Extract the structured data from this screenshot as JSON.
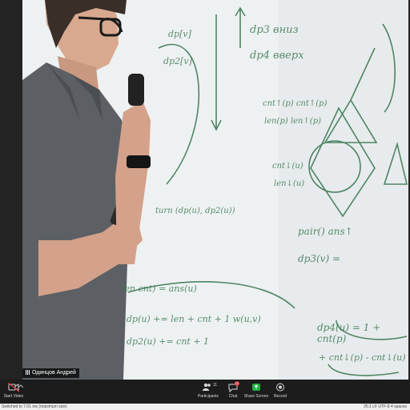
{
  "participant": {
    "name": "Одинцов Андрей"
  },
  "toolbar": {
    "start_video": "Start Video",
    "participants": "Participants",
    "participants_count": "11",
    "chat": "Chat",
    "chat_badge": "12",
    "share_screen": "Share Screen",
    "record": "Record"
  },
  "status": {
    "left": "Switched to 7.01 ms (maximum size)",
    "right": "25:1    LF    UTF-8    4 spaces"
  },
  "whiteboard": {
    "lines": [
      "dp3 вниз",
      "dp4 вверх",
      "dp[v]",
      "dp2[v]",
      "cnt↑(p) cnt↑(p)",
      "len(p) len↑(p)",
      "cnt↓(u)",
      "len↓(u)",
      "pair() ans↑",
      "dp3(v) =",
      "turn (dp(u), dp2(u))",
      "len cnt) = ans(u)",
      "dp(u) += len + cnt + 1 w(u,v)",
      "dp2(u) += cnt + 1",
      "dp4(u) = 1 + cnt(p)",
      "+ cnt↓(p) - cnt↓(u)"
    ]
  },
  "colors": {
    "toolbar_bg": "#1c1c1c",
    "marker": "#3d7a55",
    "share_green": "#1fb141",
    "badge_red": "#e23d3d"
  }
}
